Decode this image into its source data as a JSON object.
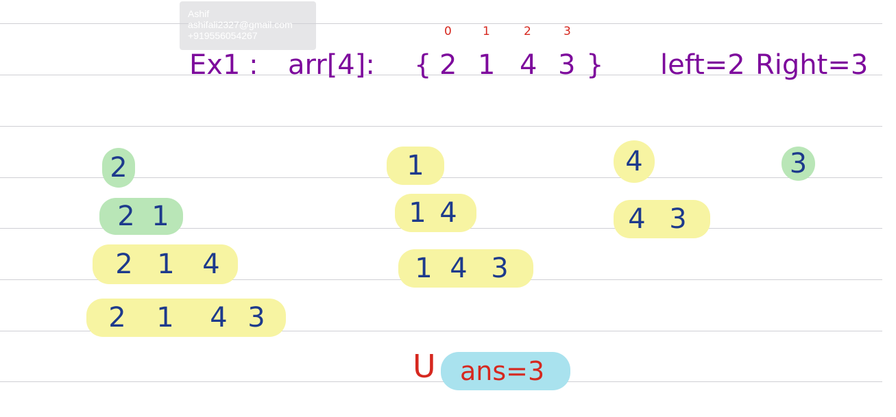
{
  "watermark": {
    "name": "Ashif",
    "email": "ashifali2327@gmail.com",
    "phone": "+919556054267"
  },
  "header": {
    "example_label": "Ex1 :",
    "array_label": "arr[4]:",
    "open_brace": "{",
    "close_brace": "}",
    "values": [
      "2",
      "1",
      "4",
      "3"
    ],
    "indices": [
      "0",
      "1",
      "2",
      "3"
    ],
    "left": "left=2",
    "right": "Right=3"
  },
  "subarrays": [
    {
      "cells": [
        "2"
      ],
      "color": "green"
    },
    {
      "cells": [
        "2",
        "1"
      ],
      "color": "green"
    },
    {
      "cells": [
        "2",
        "1",
        "4"
      ],
      "color": "yellow"
    },
    {
      "cells": [
        "2",
        "1",
        "4",
        "3"
      ],
      "color": "yellow"
    },
    {
      "cells": [
        "1"
      ],
      "color": "yellow"
    },
    {
      "cells": [
        "1",
        "4"
      ],
      "color": "yellow"
    },
    {
      "cells": [
        "1",
        "4",
        "3"
      ],
      "color": "yellow"
    },
    {
      "cells": [
        "4"
      ],
      "color": "yellow"
    },
    {
      "cells": [
        "4",
        "3"
      ],
      "color": "yellow"
    },
    {
      "cells": [
        "3"
      ],
      "color": "green"
    }
  ],
  "answer": {
    "mark": "U",
    "text": "ans=3"
  },
  "colors": {
    "heading": "#7d0a9c",
    "index": "#d6281f",
    "digits": "#1d3a8c",
    "yellow_highlight": "#f7f4a2",
    "green_highlight": "#b9e6b7",
    "answer_highlight": "#a9e2ee",
    "answer_text": "#d6281f"
  }
}
